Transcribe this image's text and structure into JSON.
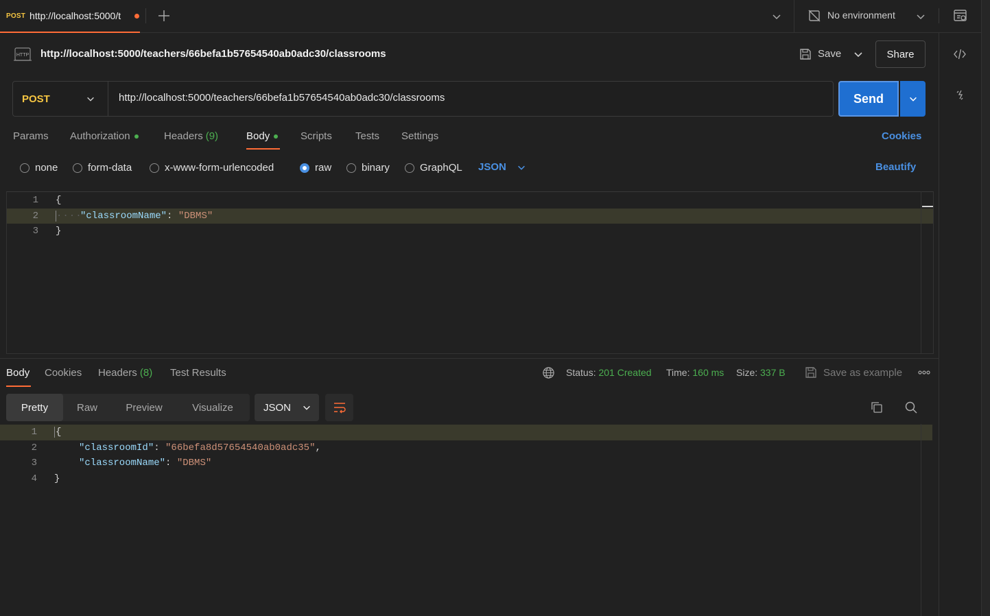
{
  "tab": {
    "method": "POST",
    "title": "http://localhost:5000/t"
  },
  "environment": {
    "label": "No environment"
  },
  "request": {
    "title": "http://localhost:5000/teachers/66befa1b57654540ab0adc30/classrooms",
    "save_label": "Save",
    "share_label": "Share",
    "method": "POST",
    "url": "http://localhost:5000/teachers/66befa1b57654540ab0adc30/classrooms",
    "send_label": "Send"
  },
  "request_tabs": {
    "params": "Params",
    "authorization": "Authorization",
    "headers": "Headers",
    "headers_count": "(9)",
    "body": "Body",
    "scripts": "Scripts",
    "tests": "Tests",
    "settings": "Settings",
    "cookies": "Cookies"
  },
  "body_types": {
    "none": "none",
    "form_data": "form-data",
    "urlencoded": "x-www-form-urlencoded",
    "raw": "raw",
    "binary": "binary",
    "graphql": "GraphQL",
    "format": "JSON",
    "beautify": "Beautify",
    "selected": "raw"
  },
  "request_body": {
    "line_numbers": [
      "1",
      "2",
      "3"
    ],
    "open_brace": "{",
    "key": "\"classroomName\"",
    "colon": ": ",
    "value": "\"DBMS\"",
    "close_brace": "}"
  },
  "response": {
    "tabs": {
      "body": "Body",
      "cookies": "Cookies",
      "headers": "Headers",
      "headers_count": "(8)",
      "test_results": "Test Results"
    },
    "status_label": "Status:",
    "status_value": "201 Created",
    "time_label": "Time:",
    "time_value": "160 ms",
    "size_label": "Size:",
    "size_value": "337 B",
    "save_example": "Save as example",
    "views": {
      "pretty": "Pretty",
      "raw": "Raw",
      "preview": "Preview",
      "visualize": "Visualize",
      "format": "JSON"
    },
    "body": {
      "line_numbers": [
        "1",
        "2",
        "3",
        "4"
      ],
      "open_brace": "{",
      "key1": "\"classroomId\"",
      "value1": "\"66befa8d57654540ab0adc35\"",
      "key2": "\"classroomName\"",
      "value2": "\"DBMS\"",
      "colon": ": ",
      "comma": ",",
      "close_brace": "}"
    }
  },
  "colors": {
    "accent_orange": "#ff6c37",
    "send_blue": "#1f6fd1",
    "link_blue": "#4a90e2",
    "method_yellow": "#f5c542",
    "success_green": "#4caf50"
  }
}
